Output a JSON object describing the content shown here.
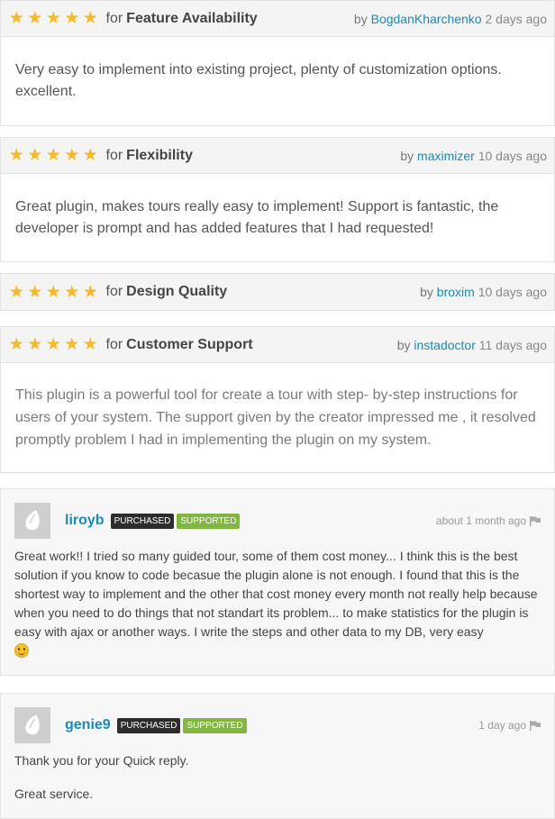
{
  "reviews": [
    {
      "stars": "★★★★★",
      "for_label": "for",
      "category": "Feature Availability",
      "by_label": "by",
      "user": "BogdanKharchenko",
      "ago": "2 days ago",
      "text": "Very easy to implement into existing project, plenty of customization options. excellent."
    },
    {
      "stars": "★★★★★",
      "for_label": "for",
      "category": "Flexibility",
      "by_label": "by",
      "user": "maximizer",
      "ago": "10 days ago",
      "text": "Great plugin, makes tours really easy to implement! Support is fantastic, the developer is prompt and has added features that I had requested!"
    },
    {
      "stars": "★★★★★",
      "for_label": "for",
      "category": "Design Quality",
      "by_label": "by",
      "user": "broxim",
      "ago": "10 days ago"
    },
    {
      "stars": "★★★★★",
      "for_label": "for",
      "category": "Customer Support",
      "by_label": "by",
      "user": "instadoctor",
      "ago": "11 days ago",
      "text": "This plugin is a powerful tool for create a tour with step- by-step instructions for users of your system. The support given by the creator impressed me , it resolved promptly problem I had in implementing the plugin on my system."
    }
  ],
  "comments": [
    {
      "user": "liroyb",
      "badge_purchased": "Purchased",
      "badge_supported": "Supported",
      "time": "about 1 month ago",
      "text": "Great work!! I tried so many guided tour, some of them cost money... I think this is the best solution if you know to code becasue the plugin alone is not enough. I found that this is the shortest way to implement and the other that cost money every month not really help because when you need to do things that not standart its problem... to make statistics for the plugin is easy with ajax or another ways. I write the steps and other data to my DB, very easy",
      "emoji": "smiley-icon"
    },
    {
      "user": "genie9",
      "badge_purchased": "Purchased",
      "badge_supported": "Supported",
      "time": "1 day ago",
      "para1": "Thank you for your Quick reply.",
      "para2": "Great service."
    }
  ],
  "colors": {
    "star": "#f6b928",
    "link": "#1a8bb3",
    "purchased_badge": "#2d2d2d",
    "supported_badge": "#82b541"
  }
}
